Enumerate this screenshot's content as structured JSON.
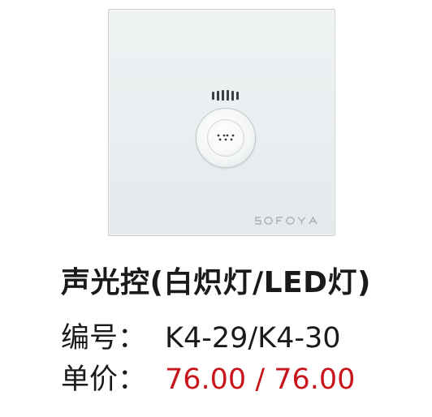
{
  "product": {
    "brand": "SOFOYA",
    "name": "声光控(白炽灯/LED灯)",
    "code_label": "编号：",
    "code_value": "K4-29/K4-30",
    "price_label": "单价：",
    "price_value": "76.00 / 76.00"
  },
  "colors": {
    "panel": "#e9eef0",
    "price": "#c8161d",
    "text": "#1a1a1a"
  }
}
